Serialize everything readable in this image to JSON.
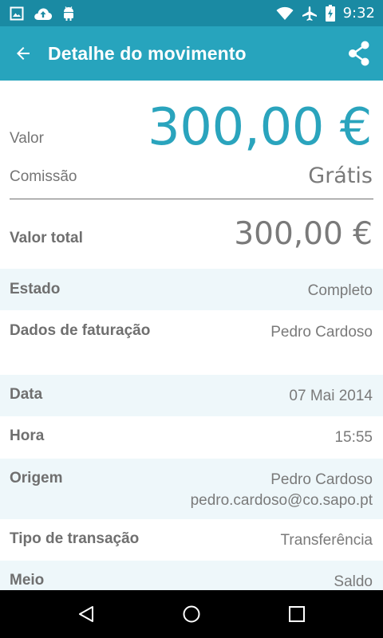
{
  "status_bar": {
    "time": "9:32",
    "left_icons": [
      "image-icon",
      "cloud-upload-icon",
      "android-icon"
    ],
    "right_icons": [
      "wifi-icon",
      "airplane-icon",
      "battery-charging-icon"
    ]
  },
  "app_bar": {
    "title": "Detalhe do movimento",
    "back_icon": "arrow-back-icon",
    "share_icon": "share-icon",
    "background": "#27a4bd"
  },
  "summary": {
    "valor_label": "Valor",
    "valor_amount": "300,00 €",
    "comissao_label": "Comissão",
    "comissao_value": "Grátis",
    "total_label": "Valor total",
    "total_amount": "300,00 €",
    "accent_color": "#2aa4bd"
  },
  "details": [
    {
      "label": "Estado",
      "values": [
        "Completo"
      ],
      "shaded": true
    },
    {
      "label": "Dados de faturação",
      "values": [
        "Pedro Cardoso"
      ],
      "shaded": false
    },
    {
      "label": "Data",
      "values": [
        "07 Mai 2014"
      ],
      "shaded": true
    },
    {
      "label": "Hora",
      "values": [
        "15:55"
      ],
      "shaded": false
    },
    {
      "label": "Origem",
      "values": [
        "Pedro Cardoso",
        "pedro.cardoso@co.sapo.pt"
      ],
      "shaded": true
    },
    {
      "label": "Tipo de transação",
      "values": [
        "Transferência"
      ],
      "shaded": false
    },
    {
      "label": "Meio",
      "values": [
        "Saldo"
      ],
      "shaded": true
    }
  ],
  "nav_bar": {
    "buttons": [
      "back-triangle-icon",
      "home-circle-icon",
      "recents-square-icon"
    ]
  }
}
